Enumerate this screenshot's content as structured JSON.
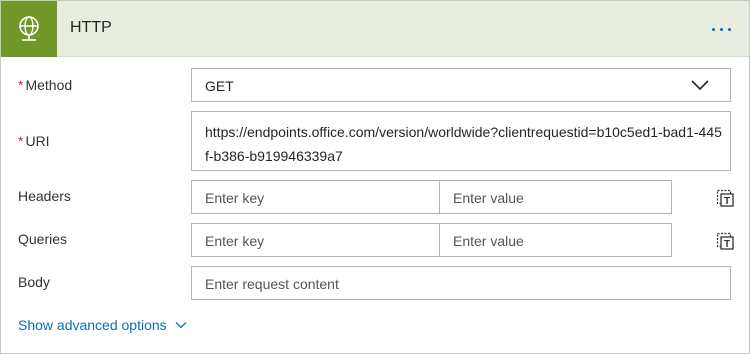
{
  "header": {
    "title": "HTTP",
    "icon": "globe-icon",
    "accent": "#709727",
    "background": "#e8eedf"
  },
  "method": {
    "required_mark": "*",
    "label": "Method",
    "value": "GET"
  },
  "uri": {
    "required_mark": "*",
    "label": "URI",
    "value": "https://endpoints.office.com/version/worldwide?clientrequestid=b10c5ed1-bad1-445f-b386-b919946339a7"
  },
  "headers": {
    "label": "Headers",
    "key_placeholder": "Enter key",
    "value_placeholder": "Enter value"
  },
  "queries": {
    "label": "Queries",
    "key_placeholder": "Enter key",
    "value_placeholder": "Enter value"
  },
  "body": {
    "label": "Body",
    "placeholder": "Enter request content"
  },
  "advanced": {
    "label": "Show advanced options"
  },
  "colors": {
    "required": "#e0224e",
    "link": "#0f6cbd"
  }
}
